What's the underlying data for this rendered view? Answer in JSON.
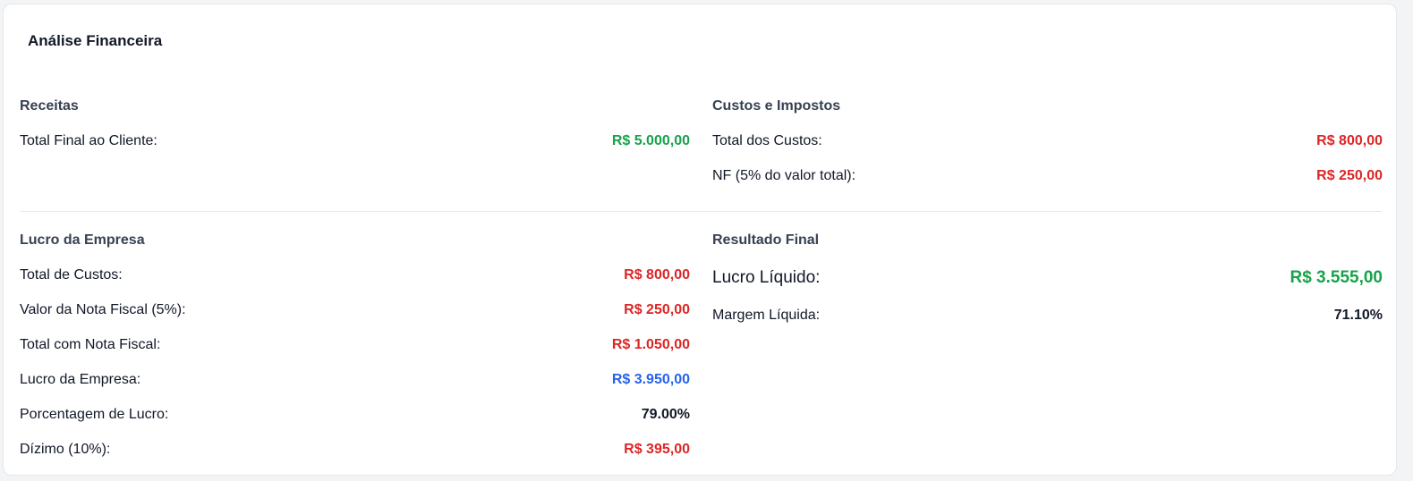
{
  "title": "Análise Financeira",
  "colors": {
    "green": "#16a34a",
    "red": "#dc2626",
    "blue": "#2563eb",
    "black": "#111827"
  },
  "receitas": {
    "title": "Receitas",
    "rows": [
      {
        "label": "Total Final ao Cliente:",
        "value": "R$ 5.000,00",
        "color": "green"
      }
    ]
  },
  "custos": {
    "title": "Custos e Impostos",
    "rows": [
      {
        "label": "Total dos Custos:",
        "value": "R$ 800,00",
        "color": "red"
      },
      {
        "label": "NF (5% do valor total):",
        "value": "R$ 250,00",
        "color": "red"
      }
    ]
  },
  "lucro": {
    "title": "Lucro da Empresa",
    "rows": [
      {
        "label": "Total de Custos:",
        "value": "R$ 800,00",
        "color": "red"
      },
      {
        "label": "Valor da Nota Fiscal (5%):",
        "value": "R$ 250,00",
        "color": "red"
      },
      {
        "label": "Total com Nota Fiscal:",
        "value": "R$ 1.050,00",
        "color": "red"
      },
      {
        "label": "Lucro da Empresa:",
        "value": "R$ 3.950,00",
        "color": "blue"
      },
      {
        "label": "Porcentagem de Lucro:",
        "value": "79.00%",
        "color": "black"
      },
      {
        "label": "Dízimo (10%):",
        "value": "R$ 395,00",
        "color": "red"
      }
    ]
  },
  "resultado": {
    "title": "Resultado Final",
    "rows": [
      {
        "label": "Lucro Líquido:",
        "value": "R$ 3.555,00",
        "color": "green"
      },
      {
        "label": "Margem Líquida:",
        "value": "71.10%",
        "color": "black"
      }
    ]
  }
}
